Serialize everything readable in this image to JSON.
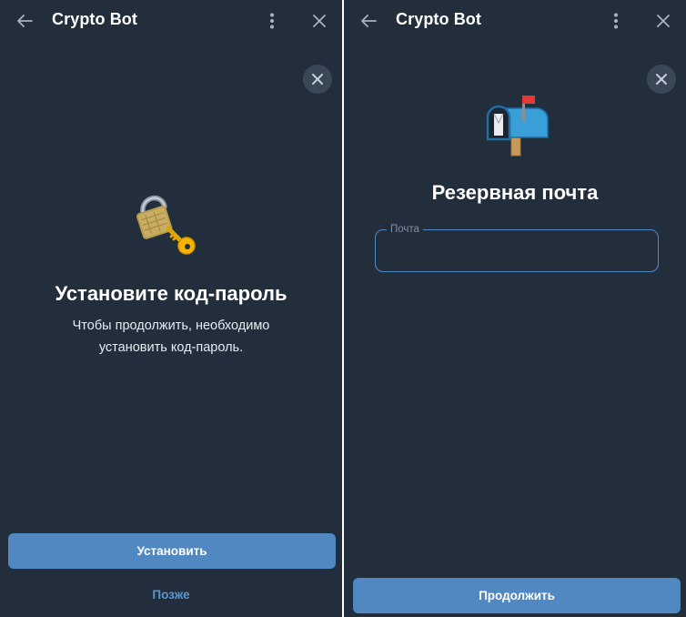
{
  "colors": {
    "background": "#232e3c",
    "accent": "#5288c1",
    "text": "#ffffff",
    "muted": "#8393a3"
  },
  "left_screen": {
    "header": {
      "title": "Crypto Bot",
      "back_icon": "arrow-left-icon",
      "menu_icon": "more-vertical-icon",
      "close_icon": "close-icon"
    },
    "dismiss_icon": "close-icon",
    "emoji": "locked-with-key",
    "title": "Установите код-пароль",
    "description_line1": "Чтобы продолжить, необходимо",
    "description_line2": "установить код-пароль.",
    "primary_button": "Установить",
    "secondary_button": "Позже"
  },
  "right_screen": {
    "header": {
      "title": "Crypto Bot",
      "back_icon": "arrow-left-icon",
      "menu_icon": "more-vertical-icon",
      "close_icon": "close-icon"
    },
    "dismiss_icon": "close-icon",
    "emoji": "open-mailbox-with-raised-flag",
    "title": "Резервная почта",
    "email_field": {
      "label": "Почта",
      "value": ""
    },
    "primary_button": "Продолжить"
  }
}
